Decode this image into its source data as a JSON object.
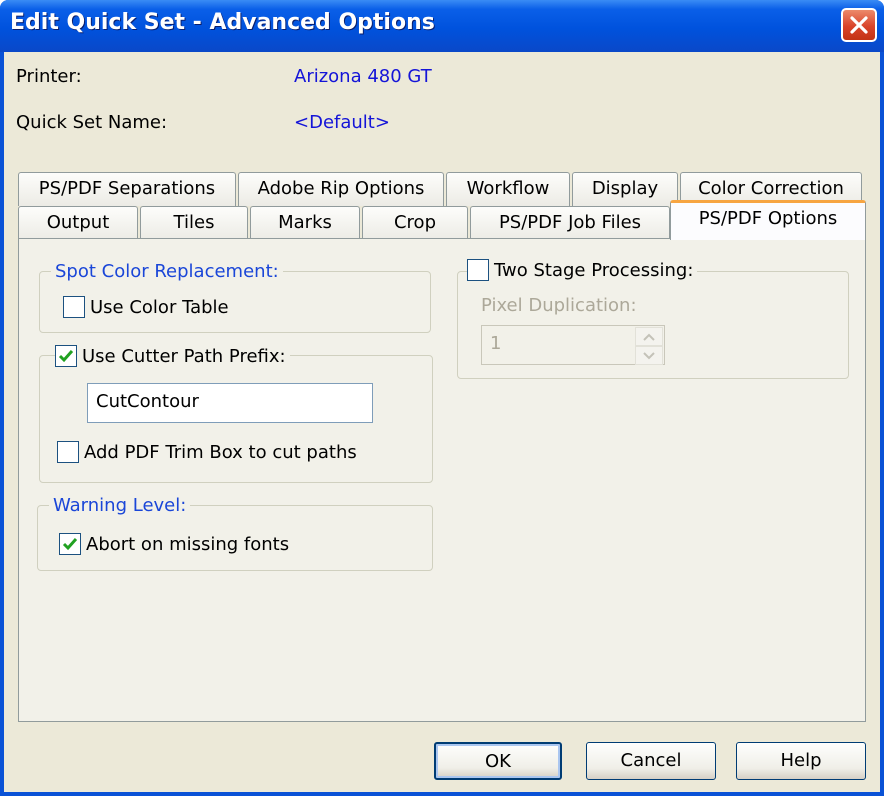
{
  "window": {
    "title": "Edit Quick Set - Advanced Options"
  },
  "fields": {
    "printer_label": "Printer:",
    "printer_value": "Arizona 480 GT",
    "quickset_label": "Quick Set Name:",
    "quickset_value": "<Default>"
  },
  "tabs": {
    "row1": [
      "PS/PDF Separations",
      "Adobe Rip Options",
      "Workflow",
      "Display",
      "Color Correction"
    ],
    "row2": [
      "Output",
      "Tiles",
      "Marks",
      "Crop",
      "PS/PDF Job Files",
      "PS/PDF Options"
    ],
    "active": "PS/PDF Options"
  },
  "panel": {
    "spot_color": {
      "caption": "Spot Color Replacement:",
      "use_color_table_label": "Use Color Table",
      "use_color_table_checked": false
    },
    "cutter_path": {
      "caption": "Use Cutter Path Prefix:",
      "checked": true,
      "prefix_value": "CutContour",
      "trim_box_label": "Add PDF Trim Box to cut paths",
      "trim_box_checked": false
    },
    "warning": {
      "caption": "Warning Level:",
      "abort_label": "Abort on missing fonts",
      "abort_checked": true
    },
    "two_stage": {
      "caption": "Two Stage Processing:",
      "checked": false,
      "pixel_dup_label": "Pixel Duplication:",
      "pixel_dup_value": "1"
    }
  },
  "buttons": {
    "ok": "OK",
    "cancel": "Cancel",
    "help": "Help"
  },
  "colors": {
    "title_bar": "#0052dd",
    "link_text": "#1414d8",
    "group_caption": "#1a46d8",
    "check_mark": "#21a121",
    "active_tab_accent": "#f7a541"
  }
}
